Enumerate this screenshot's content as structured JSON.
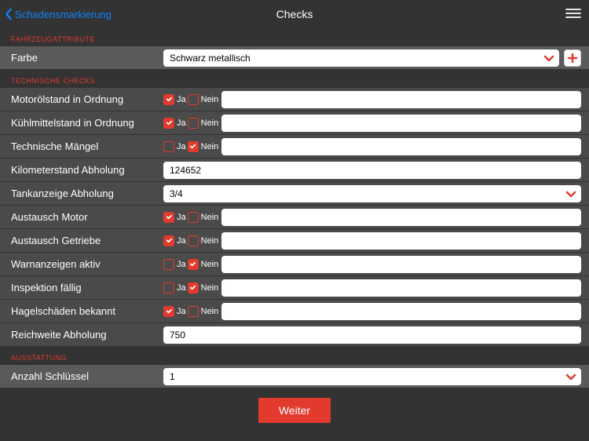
{
  "header": {
    "back_label": "Schadensmarkierung",
    "title": "Checks"
  },
  "sections": {
    "attrs": {
      "title": "FAHRZEUGATTRIBUTE",
      "color_label": "Farbe",
      "color_value": "Schwarz metallisch"
    },
    "tech": {
      "title": "TECHNISCHE CHECKS",
      "yes": "Ja",
      "no": "Nein",
      "rows": {
        "oil": {
          "label": "Motorölstand in Ordnung",
          "yes": true,
          "no": false,
          "note": ""
        },
        "coolant": {
          "label": "Kühlmittelstand in Ordnung",
          "yes": true,
          "no": false,
          "note": ""
        },
        "defects": {
          "label": "Technische Mängel",
          "yes": false,
          "no": true,
          "note": ""
        },
        "odo": {
          "label": "Kilometerstand Abholung",
          "value": "124652"
        },
        "fuel": {
          "label": "Tankanzeige Abholung",
          "value": "3/4"
        },
        "engine": {
          "label": "Austausch Motor",
          "yes": true,
          "no": false,
          "note": ""
        },
        "gearbox": {
          "label": "Austausch Getriebe",
          "yes": true,
          "no": false,
          "note": ""
        },
        "warning": {
          "label": "Warnanzeigen aktiv",
          "yes": false,
          "no": true,
          "note": ""
        },
        "inspection": {
          "label": "Inspektion fällig",
          "yes": false,
          "no": true,
          "note": ""
        },
        "hail": {
          "label": "Hagelschäden bekannt",
          "yes": true,
          "no": false,
          "note": ""
        },
        "range": {
          "label": "Reichweite Abholung",
          "value": "750"
        }
      }
    },
    "equip": {
      "title": "AUSSTATTUNG",
      "keys_label": "Anzahl Schlüssel",
      "keys_value": "1"
    }
  },
  "footer": {
    "continue": "Weiter"
  },
  "colors": {
    "accent": "#e23b2e",
    "link": "#0a84ff"
  }
}
